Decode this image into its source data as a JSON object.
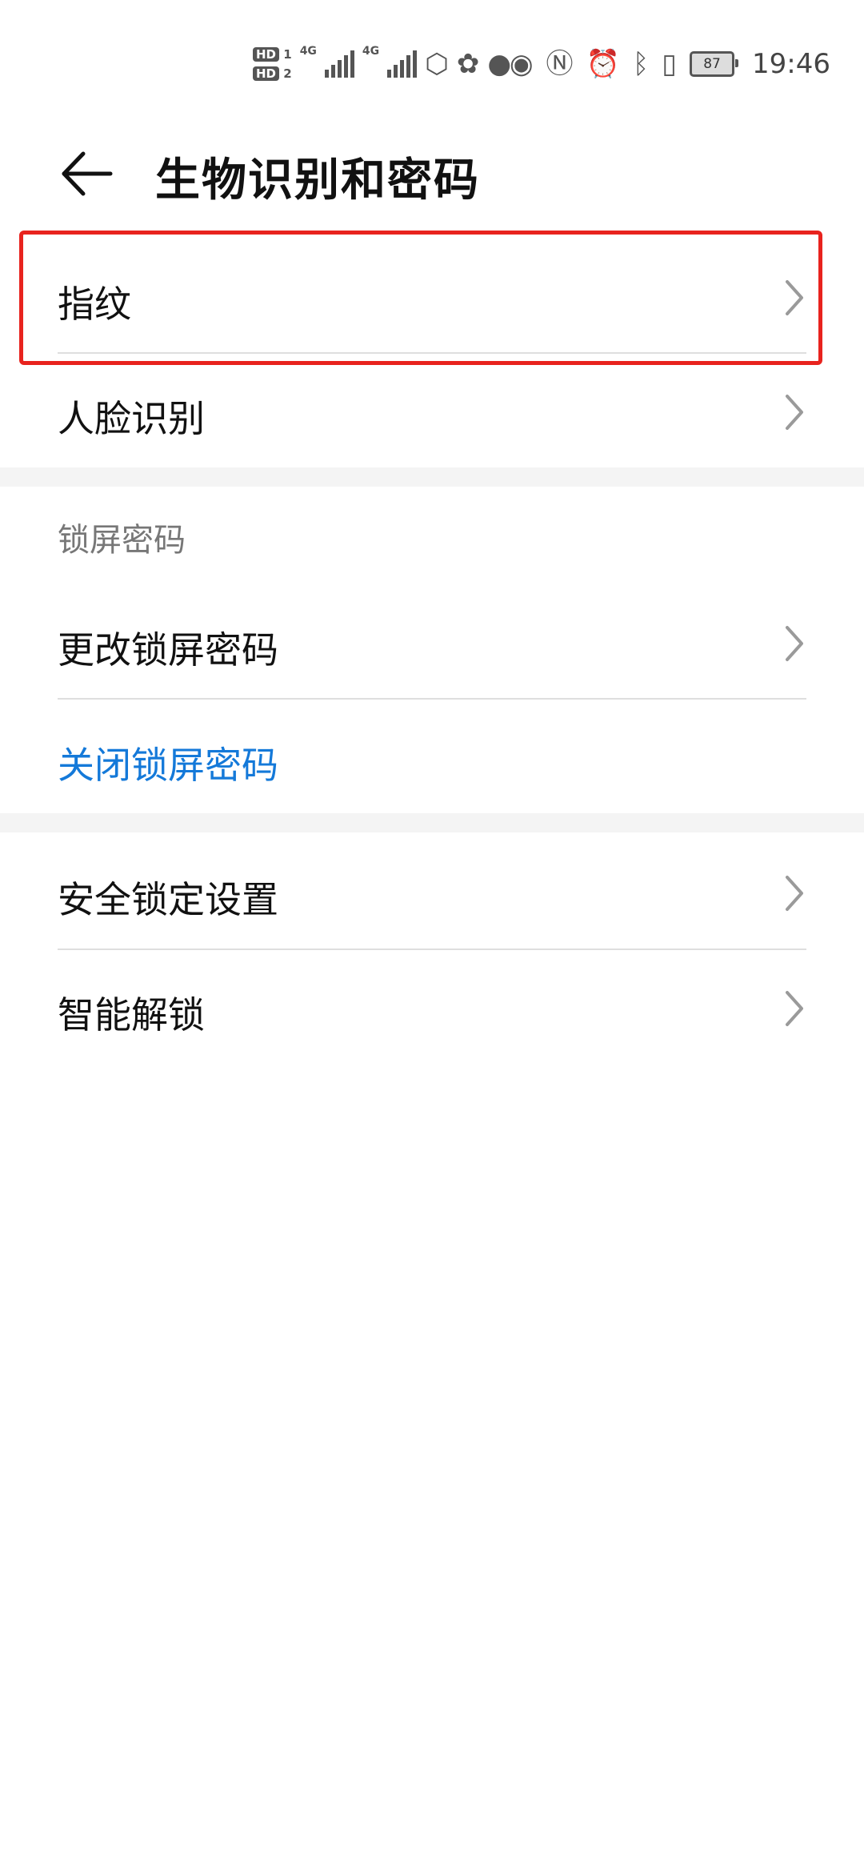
{
  "status_bar": {
    "hd1": "HD",
    "hd2": "HD",
    "sim1": "1",
    "sim2": "2",
    "net1": "4G",
    "net2": "4G",
    "battery": "87",
    "time": "19:46",
    "icons": [
      "signal-icon",
      "signal-icon",
      "shield-app-icon",
      "wechat-icon",
      "message-icon",
      "eye-icon",
      "nfc-icon",
      "alarm-icon",
      "bluetooth-icon",
      "vibrate-icon",
      "battery-icon"
    ]
  },
  "header": {
    "title": "生物识别和密码",
    "back_icon": "back-arrow-icon"
  },
  "items": {
    "fingerprint": "指纹",
    "face": "人脸识别",
    "lock_section": "锁屏密码",
    "change_lock": "更改锁屏密码",
    "close_lock": "关闭锁屏密码",
    "security_lock": "安全锁定设置",
    "smart_unlock": "智能解锁"
  },
  "colors": {
    "accent_blue": "#1479d9",
    "highlight_red": "#e8231e",
    "section_gray": "#f4f4f4"
  }
}
